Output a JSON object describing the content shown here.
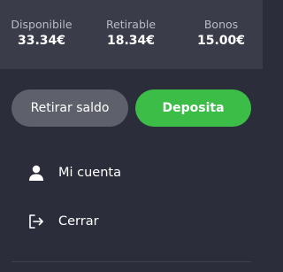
{
  "balances": {
    "available": {
      "label": "Disponibile",
      "value": "33.34€"
    },
    "withdrawable": {
      "label": "Retirable",
      "value": "18.34€"
    },
    "bonus": {
      "label": "Bonos",
      "value": "15.00€"
    }
  },
  "actions": {
    "withdraw_label": "Retirar saldo",
    "deposit_label": "Deposita"
  },
  "menu": {
    "account": {
      "label": "Mi cuenta",
      "icon": "user-icon"
    },
    "logout": {
      "label": "Cerrar",
      "icon": "logout-icon"
    }
  },
  "colors": {
    "background": "#2b2e3a",
    "balance_bar": "#3a3d49",
    "withdraw_button": "#5e616b",
    "deposit_button": "#3bbd48"
  }
}
